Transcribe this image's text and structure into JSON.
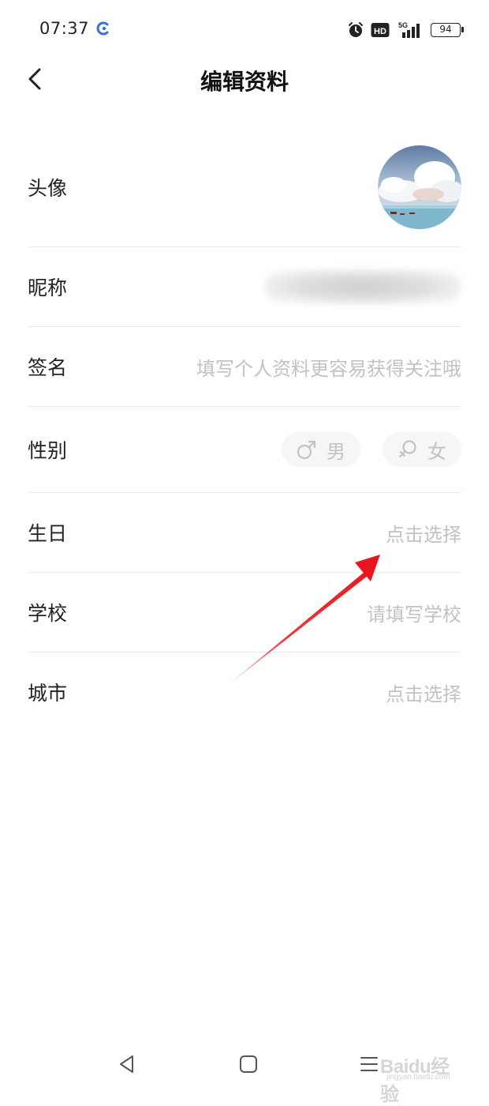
{
  "status_bar": {
    "time": "07:37",
    "network": "5G",
    "hd": "HD",
    "battery": "94",
    "icons": [
      "app-c-icon",
      "alarm-icon",
      "hd-icon",
      "signal-5g-icon",
      "battery-icon"
    ]
  },
  "header": {
    "title": "编辑资料",
    "back_icon": "chevron-left-icon"
  },
  "rows": {
    "avatar": {
      "label": "头像"
    },
    "nickname": {
      "label": "昵称"
    },
    "signature": {
      "label": "签名",
      "placeholder": "填写个人资料更容易获得关注哦"
    },
    "gender": {
      "label": "性别",
      "male": "男",
      "female": "女"
    },
    "birthday": {
      "label": "生日",
      "placeholder": "点击选择"
    },
    "school": {
      "label": "学校",
      "placeholder": "请填写学校"
    },
    "city": {
      "label": "城市",
      "placeholder": "点击选择"
    }
  },
  "system_nav": {
    "icons": [
      "nav-back-icon",
      "nav-home-icon",
      "nav-menu-icon"
    ]
  },
  "watermark": {
    "brand": "Baidu经验",
    "sub": "jingyan.baidu.com"
  },
  "colors": {
    "placeholder": "#c2c2c2",
    "divider": "#ececec",
    "arrow": "#e8141e"
  }
}
